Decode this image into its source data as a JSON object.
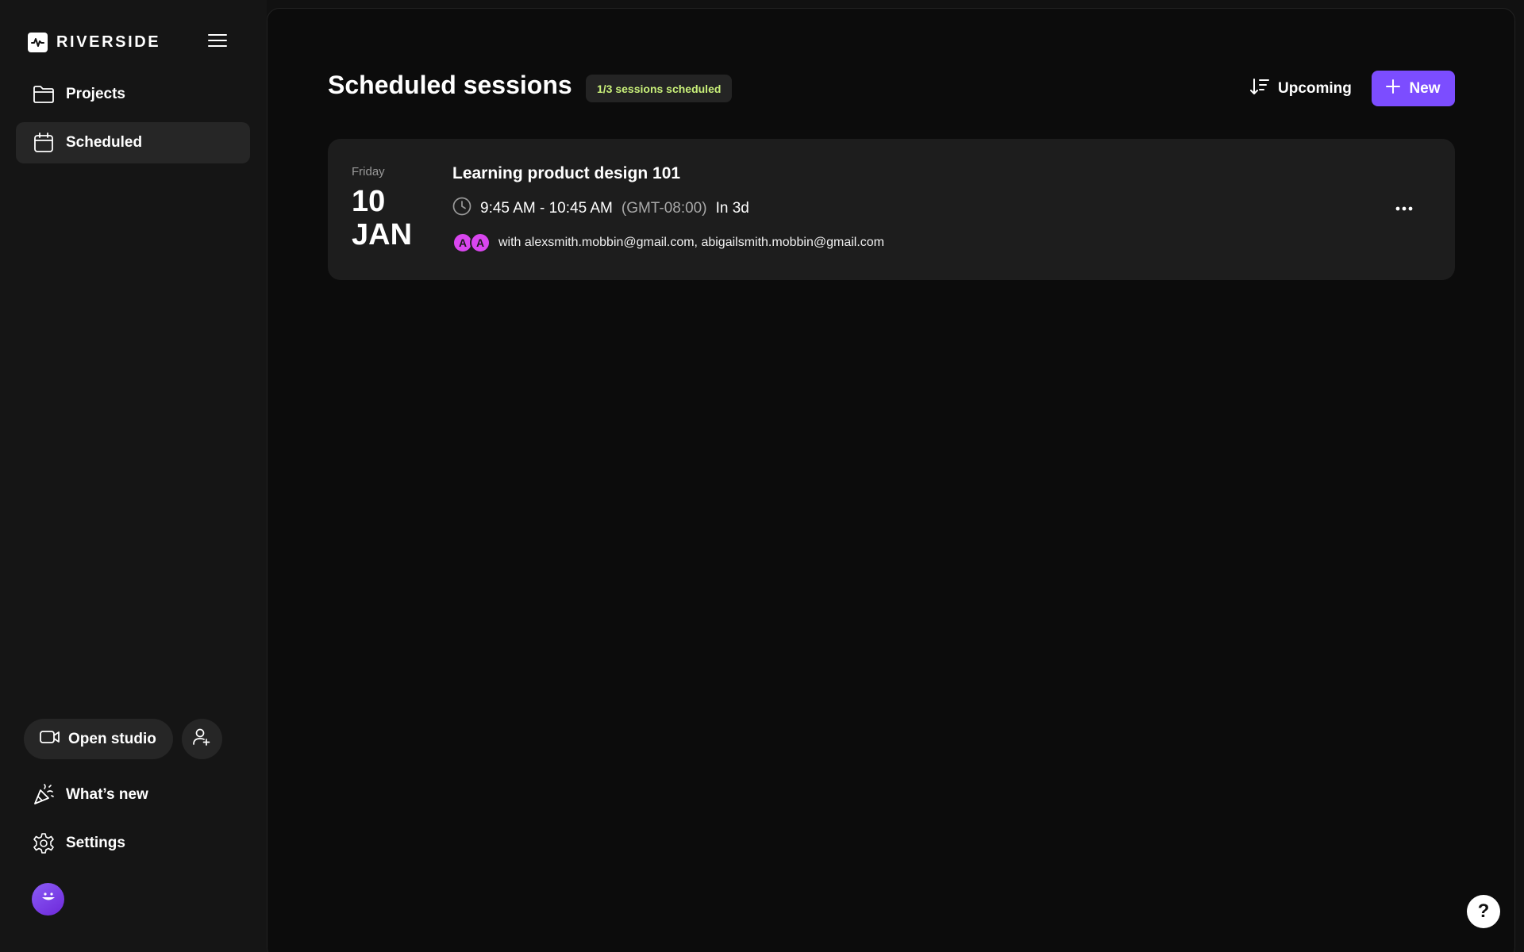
{
  "brand": {
    "name": "RIVERSIDE",
    "logo_icon": "waveform-icon"
  },
  "sidebar": {
    "menu_icon": "hamburger-icon",
    "items": [
      {
        "label": "Projects",
        "icon": "folder-icon",
        "active": false
      },
      {
        "label": "Scheduled",
        "icon": "calendar-icon",
        "active": true
      }
    ],
    "open_studio_label": "Open studio",
    "open_studio_icon": "video-camera-icon",
    "invite_icon": "add-user-icon",
    "whats_new_label": "What’s new",
    "whats_new_icon": "party-popper-icon",
    "settings_label": "Settings",
    "settings_icon": "gear-icon",
    "avatar_icon": "smiley-face-icon"
  },
  "header": {
    "title": "Scheduled sessions",
    "quota_badge": "1/3 sessions scheduled",
    "sort_label": "Upcoming",
    "sort_icon": "sort-descending-icon",
    "new_label": "New",
    "new_icon": "plus-icon"
  },
  "sessions": [
    {
      "weekday": "Friday",
      "day": "10",
      "month": "JAN",
      "title": "Learning product design 101",
      "time_range": "9:45 AM - 10:45 AM",
      "timezone": "(GMT-08:00)",
      "relative": "In 3d",
      "guest_initials": [
        "A",
        "A"
      ],
      "guests_text": "with alexsmith.mobbin@gmail.com, abigailsmith.mobbin@gmail.com"
    }
  ],
  "help_label": "?",
  "colors": {
    "accent": "#7c4dff",
    "badge_text": "#c9f07a",
    "guest_avatar": "#d946ef",
    "card_bg": "#1d1d1d"
  }
}
